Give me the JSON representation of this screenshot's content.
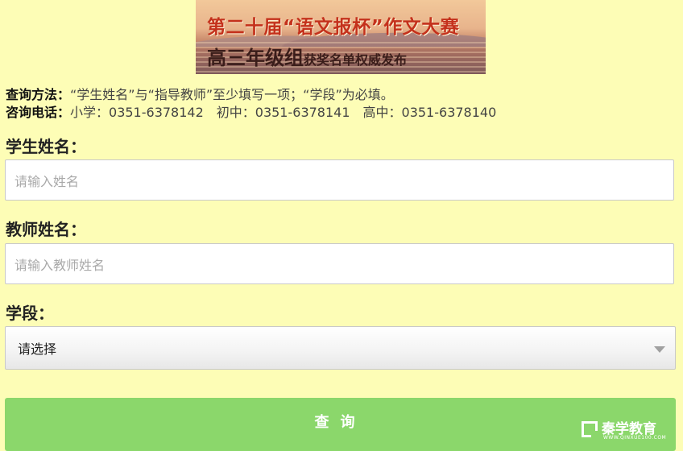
{
  "banner": {
    "line1": "第二十届“语文报杯”作文大赛",
    "line2_big": "高三年级组",
    "line2_small": "获奖名单权威发布"
  },
  "info": {
    "method_label": "查询方法：",
    "method_text": "“学生姓名”与“指导教师”至少填写一项；“学段”为必填。",
    "phone_label": "咨询电话：",
    "phone_text": "小学：0351-6378142　初中：0351-6378141　高中：0351-6378140"
  },
  "form": {
    "student_label": "学生姓名：",
    "student_placeholder": "请输入姓名",
    "student_value": "",
    "teacher_label": "教师姓名：",
    "teacher_placeholder": "请输入教师姓名",
    "teacher_value": "",
    "stage_label": "学段：",
    "stage_selected": "请选择",
    "submit_label": "查询"
  },
  "watermark": {
    "text": "秦学教育",
    "sub": "WWW.QINXUE100.COM"
  },
  "colors": {
    "background": "#fdfdb6",
    "button": "#8bd76b"
  },
  "icons": {
    "select_caret": "chevron-down-icon"
  }
}
